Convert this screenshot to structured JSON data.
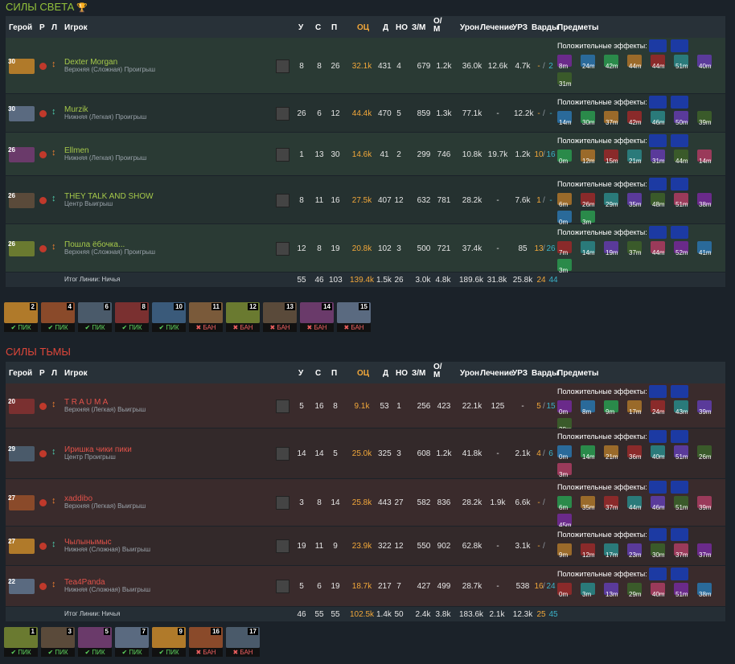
{
  "radiant": {
    "title": "СИЛЫ СВЕТА",
    "trophy_icon": "trophy-icon"
  },
  "dire": {
    "title": "СИЛЫ ТЬМЫ"
  },
  "headers": {
    "hero": "Герой",
    "r": "Р",
    "l": "Л",
    "player": "Игрок",
    "k": "У",
    "d": "С",
    "a": "П",
    "nw": "ОЦ",
    "lh": "Д",
    "dn": "НО",
    "gpm": "З/М",
    "xpm": "О/ М",
    "dmg": "Урон",
    "heal": "Лечение",
    "bld": "УРЗ",
    "wards": "Варды",
    "items": "Предметы"
  },
  "buff_label": "Положительные эффекты:",
  "radiant_players": [
    {
      "lvl": "30",
      "name": "Dexter Morgan",
      "lane": "Верхняя (Сложная) Проигрыш",
      "k": "8",
      "d": "8",
      "a": "26",
      "nw": "32.1k",
      "lh": "431",
      "dn": "4",
      "gpm": "679",
      "xpm": "1.2k",
      "dmg": "36.0k",
      "heal": "12.6k",
      "bld": "4.7k",
      "wo": "-",
      "wb": "2",
      "times": [
        "8m",
        "24m",
        "42m",
        "44m",
        "44m",
        "51m",
        "40m",
        "31m"
      ]
    },
    {
      "lvl": "30",
      "name": "Murzik",
      "lane": "Нижняя (Легкая) Проигрыш",
      "k": "26",
      "d": "6",
      "a": "12",
      "nw": "44.4k",
      "lh": "470",
      "dn": "5",
      "gpm": "859",
      "xpm": "1.3k",
      "dmg": "77.1k",
      "heal": "-",
      "bld": "12.2k",
      "wo": "-",
      "wb": "-",
      "times": [
        "14m",
        "30m",
        "37m",
        "42m",
        "46m",
        "50m",
        "39m"
      ]
    },
    {
      "lvl": "26",
      "name": "Ellmen",
      "lane": "Нижняя (Легкая) Проигрыш",
      "k": "1",
      "d": "13",
      "a": "30",
      "nw": "14.6k",
      "lh": "41",
      "dn": "2",
      "gpm": "299",
      "xpm": "746",
      "dmg": "10.8k",
      "heal": "19.7k",
      "bld": "1.2k",
      "wo": "10",
      "wb": "16",
      "times": [
        "0m",
        "12m",
        "15m",
        "21m",
        "31m",
        "44m",
        "14m"
      ]
    },
    {
      "lvl": "26",
      "name": "THEY TALK AND SHOW",
      "lane": "Центр Выигрыш",
      "k": "8",
      "d": "11",
      "a": "16",
      "nw": "27.5k",
      "lh": "407",
      "dn": "12",
      "gpm": "632",
      "xpm": "781",
      "dmg": "28.2k",
      "heal": "-",
      "bld": "7.6k",
      "wo": "1",
      "wb": "-",
      "times": [
        "6m",
        "26m",
        "29m",
        "35m",
        "48m",
        "51m",
        "38m",
        "0m",
        "3m"
      ]
    },
    {
      "lvl": "26",
      "name": "Пошла ёбочка...",
      "lane": "Верхняя (Сложная) Проигрыш",
      "k": "12",
      "d": "8",
      "a": "19",
      "nw": "20.8k",
      "lh": "102",
      "dn": "3",
      "gpm": "500",
      "xpm": "721",
      "dmg": "37.4k",
      "heal": "-",
      "bld": "85",
      "wo": "13",
      "wb": "26",
      "times": [
        "7m",
        "14m",
        "19m",
        "37m",
        "44m",
        "52m",
        "41m",
        "3m"
      ]
    }
  ],
  "radiant_total": {
    "label": "Итог Линии: Ничья",
    "k": "55",
    "d": "46",
    "a": "103",
    "nw": "139.4k",
    "lh": "1.5k",
    "dn": "26",
    "gpm": "3.0k",
    "xpm": "4.8k",
    "dmg": "189.6k",
    "heal": "31.8k",
    "bld": "25.8k",
    "wo": "24",
    "wb": "44"
  },
  "radiant_picks": [
    {
      "n": "2",
      "tag": "✔ ПИК"
    },
    {
      "n": "4",
      "tag": "✔ ПИК"
    },
    {
      "n": "6",
      "tag": "✔ ПИК"
    },
    {
      "n": "8",
      "tag": "✔ ПИК"
    },
    {
      "n": "10",
      "tag": "✔ ПИК"
    },
    {
      "n": "11",
      "tag": "✖ БАН"
    },
    {
      "n": "12",
      "tag": "✖ БАН"
    },
    {
      "n": "13",
      "tag": "✖ БАН"
    },
    {
      "n": "14",
      "tag": "✖ БАН"
    },
    {
      "n": "15",
      "tag": "✖ БАН"
    }
  ],
  "dire_players": [
    {
      "lvl": "20",
      "name": "T R A U M A",
      "lane": "Верхняя (Легкая) Выигрыш",
      "k": "5",
      "d": "16",
      "a": "8",
      "nw": "9.1k",
      "lh": "53",
      "dn": "1",
      "gpm": "256",
      "xpm": "423",
      "dmg": "22.1k",
      "heal": "125",
      "bld": "-",
      "wo": "5",
      "wb": "15",
      "times": [
        "0m",
        "8m",
        "9m",
        "17m",
        "24m",
        "43m",
        "39m",
        "38m"
      ]
    },
    {
      "lvl": "29",
      "name": "Иришка чики пики",
      "lane": "Центр Проигрыш",
      "k": "14",
      "d": "14",
      "a": "5",
      "nw": "25.0k",
      "lh": "325",
      "dn": "3",
      "gpm": "608",
      "xpm": "1.2k",
      "dmg": "41.8k",
      "heal": "-",
      "bld": "2.1k",
      "wo": "4",
      "wb": "6",
      "times": [
        "0m",
        "14m",
        "21m",
        "36m",
        "40m",
        "51m",
        "26m",
        "3m"
      ]
    },
    {
      "lvl": "27",
      "name": "xaddibo",
      "lane": "Верхняя (Легкая) Выигрыш",
      "k": "3",
      "d": "8",
      "a": "14",
      "nw": "25.8k",
      "lh": "443",
      "dn": "27",
      "gpm": "582",
      "xpm": "836",
      "dmg": "28.2k",
      "heal": "1.9k",
      "bld": "6.6k",
      "wo": "-",
      "wb": "",
      "times": [
        "6m",
        "35m",
        "37m",
        "44m",
        "46m",
        "51m",
        "39m",
        "45m"
      ]
    },
    {
      "lvl": "27",
      "name": "Чылынымыс",
      "lane": "Нижняя (Сложная) Выигрыш",
      "k": "19",
      "d": "11",
      "a": "9",
      "nw": "23.9k",
      "lh": "322",
      "dn": "12",
      "gpm": "550",
      "xpm": "902",
      "dmg": "62.8k",
      "heal": "-",
      "bld": "3.1k",
      "wo": "-",
      "wb": "",
      "times": [
        "9m",
        "12m",
        "17m",
        "23m",
        "30m",
        "37m",
        "37m"
      ]
    },
    {
      "lvl": "22",
      "name": "Tea4Panda",
      "lane": "Нижняя (Сложная) Выигрыш",
      "k": "5",
      "d": "6",
      "a": "19",
      "nw": "18.7k",
      "lh": "217",
      "dn": "7",
      "gpm": "427",
      "xpm": "499",
      "dmg": "28.7k",
      "heal": "-",
      "bld": "538",
      "wo": "16",
      "wb": "24",
      "times": [
        "0m",
        "3m",
        "13m",
        "29m",
        "40m",
        "51m",
        "38m"
      ]
    }
  ],
  "dire_total": {
    "label": "Итог Линии: Ничья",
    "k": "46",
    "d": "55",
    "a": "55",
    "nw": "102.5k",
    "lh": "1.4k",
    "dn": "50",
    "gpm": "2.4k",
    "xpm": "3.8k",
    "dmg": "183.6k",
    "heal": "2.1k",
    "bld": "12.3k",
    "wo": "25",
    "wb": "45"
  },
  "dire_picks": [
    {
      "n": "1",
      "tag": "✔ ПИК"
    },
    {
      "n": "3",
      "tag": "✔ ПИК"
    },
    {
      "n": "5",
      "tag": "✔ ПИК"
    },
    {
      "n": "7",
      "tag": "✔ ПИК"
    },
    {
      "n": "9",
      "tag": "✔ ПИК"
    },
    {
      "n": "16",
      "tag": "✖ БАН"
    },
    {
      "n": "17",
      "tag": "✖ БАН"
    }
  ],
  "colors": {
    "radiant": "#92c13a",
    "dire": "#e0473a",
    "networth": "#f1a73a",
    "wards_blue": "#3bb3c9"
  }
}
